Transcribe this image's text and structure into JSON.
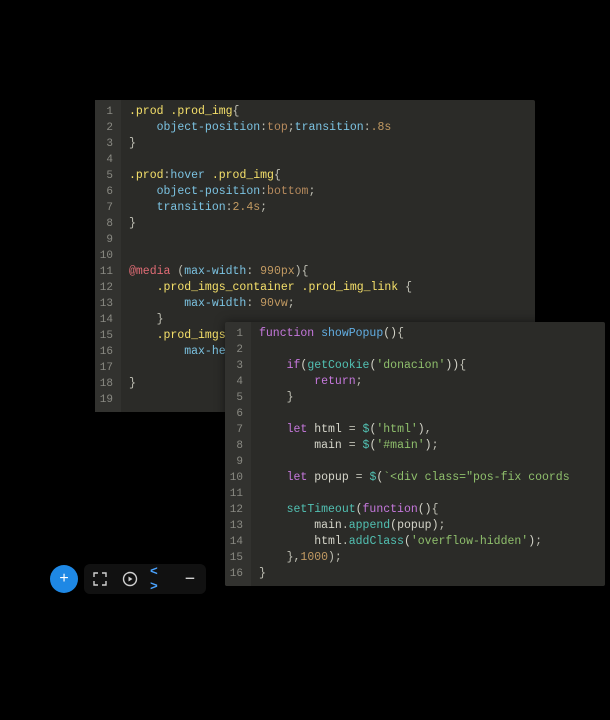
{
  "css_editor": {
    "lines": [
      {
        "n": 1,
        "tokens": [
          [
            "selector",
            ".prod "
          ],
          [
            "selector",
            ".prod_img"
          ],
          [
            "punct",
            "{"
          ]
        ]
      },
      {
        "n": 2,
        "indent": 1,
        "tokens": [
          [
            "prop",
            "object-position"
          ],
          [
            "punct",
            ":"
          ],
          [
            "value",
            "top"
          ],
          [
            "punct",
            ";"
          ],
          [
            "prop",
            "transition"
          ],
          [
            "punct",
            ":"
          ],
          [
            "number",
            ".8s"
          ]
        ]
      },
      {
        "n": 3,
        "tokens": [
          [
            "punct",
            "}"
          ]
        ]
      },
      {
        "n": 4,
        "tokens": []
      },
      {
        "n": 5,
        "tokens": [
          [
            "selector",
            ".prod"
          ],
          [
            "punct",
            ":"
          ],
          [
            "pseudo",
            "hover "
          ],
          [
            "selector",
            ".prod_img"
          ],
          [
            "punct",
            "{"
          ]
        ]
      },
      {
        "n": 6,
        "indent": 1,
        "tokens": [
          [
            "prop",
            "object-position"
          ],
          [
            "punct",
            ":"
          ],
          [
            "value",
            "bottom"
          ],
          [
            "punct",
            ";"
          ]
        ]
      },
      {
        "n": 7,
        "indent": 1,
        "tokens": [
          [
            "prop",
            "transition"
          ],
          [
            "punct",
            ":"
          ],
          [
            "number",
            "2.4s"
          ],
          [
            "punct",
            ";"
          ]
        ]
      },
      {
        "n": 8,
        "tokens": [
          [
            "punct",
            "}"
          ]
        ]
      },
      {
        "n": 9,
        "tokens": []
      },
      {
        "n": 10,
        "tokens": []
      },
      {
        "n": 11,
        "tokens": [
          [
            "keyword2",
            "@media "
          ],
          [
            "punct",
            "("
          ],
          [
            "prop",
            "max-width"
          ],
          [
            "punct",
            ": "
          ],
          [
            "number",
            "990px"
          ],
          [
            "punct",
            ")"
          ],
          [
            "punct",
            "{"
          ]
        ]
      },
      {
        "n": 12,
        "indent": 1,
        "tokens": [
          [
            "selector",
            ".prod_imgs_container "
          ],
          [
            "selector",
            ".prod_img_link "
          ],
          [
            "punct",
            "{"
          ]
        ]
      },
      {
        "n": 13,
        "indent": 2,
        "tokens": [
          [
            "prop",
            "max-width"
          ],
          [
            "punct",
            ": "
          ],
          [
            "number",
            "90vw"
          ],
          [
            "punct",
            ";"
          ]
        ]
      },
      {
        "n": 14,
        "indent": 1,
        "tokens": [
          [
            "punct",
            "}"
          ]
        ]
      },
      {
        "n": 15,
        "indent": 1,
        "tokens": [
          [
            "selector",
            ".prod_imgs"
          ]
        ]
      },
      {
        "n": 16,
        "indent": 2,
        "tokens": [
          [
            "prop",
            "max-he"
          ]
        ]
      },
      {
        "n": 17,
        "indent": 1,
        "tokens": [
          [
            "punct",
            ""
          ]
        ]
      },
      {
        "n": 18,
        "tokens": [
          [
            "punct",
            "}"
          ]
        ]
      },
      {
        "n": 19,
        "tokens": []
      }
    ]
  },
  "js_editor": {
    "lines": [
      {
        "n": 1,
        "tokens": [
          [
            "keyword",
            "function "
          ],
          [
            "func",
            "showPopup"
          ],
          [
            "paren",
            "()"
          ],
          [
            "punct",
            "{"
          ]
        ]
      },
      {
        "n": 2,
        "tokens": []
      },
      {
        "n": 3,
        "indent": 1,
        "tokens": [
          [
            "keyword",
            "if"
          ],
          [
            "paren",
            "("
          ],
          [
            "call",
            "getCookie"
          ],
          [
            "paren",
            "("
          ],
          [
            "string",
            "'donacion'"
          ],
          [
            "paren",
            "))"
          ],
          [
            "punct",
            "{"
          ]
        ]
      },
      {
        "n": 4,
        "indent": 2,
        "tokens": [
          [
            "keyword",
            "return"
          ],
          [
            "punct",
            ";"
          ]
        ]
      },
      {
        "n": 5,
        "indent": 1,
        "tokens": [
          [
            "punct",
            "}"
          ]
        ]
      },
      {
        "n": 6,
        "tokens": []
      },
      {
        "n": 7,
        "indent": 1,
        "tokens": [
          [
            "keyword",
            "let "
          ],
          [
            "ident",
            "html "
          ],
          [
            "punct",
            "= "
          ],
          [
            "call",
            "$"
          ],
          [
            "paren",
            "("
          ],
          [
            "string",
            "'html'"
          ],
          [
            "paren",
            ")"
          ],
          [
            "punct",
            ","
          ]
        ]
      },
      {
        "n": 8,
        "indent": 2,
        "tokens": [
          [
            "ident",
            "main "
          ],
          [
            "punct",
            "= "
          ],
          [
            "call",
            "$"
          ],
          [
            "paren",
            "("
          ],
          [
            "string",
            "'#main'"
          ],
          [
            "paren",
            ")"
          ],
          [
            "punct",
            ";"
          ]
        ]
      },
      {
        "n": 9,
        "tokens": []
      },
      {
        "n": 10,
        "indent": 1,
        "tokens": [
          [
            "keyword",
            "let "
          ],
          [
            "ident",
            "popup "
          ],
          [
            "punct",
            "= "
          ],
          [
            "call",
            "$"
          ],
          [
            "paren",
            "("
          ],
          [
            "string",
            "`<div class=\"pos-fix coords"
          ]
        ]
      },
      {
        "n": 11,
        "tokens": []
      },
      {
        "n": 12,
        "indent": 1,
        "tokens": [
          [
            "call",
            "setTimeout"
          ],
          [
            "paren",
            "("
          ],
          [
            "keyword",
            "function"
          ],
          [
            "paren",
            "()"
          ],
          [
            "punct",
            "{"
          ]
        ]
      },
      {
        "n": 13,
        "indent": 2,
        "tokens": [
          [
            "ident",
            "main"
          ],
          [
            "punct",
            "."
          ],
          [
            "method",
            "append"
          ],
          [
            "paren",
            "("
          ],
          [
            "ident",
            "popup"
          ],
          [
            "paren",
            ")"
          ],
          [
            "punct",
            ";"
          ]
        ]
      },
      {
        "n": 14,
        "indent": 2,
        "tokens": [
          [
            "ident",
            "html"
          ],
          [
            "punct",
            "."
          ],
          [
            "method",
            "addClass"
          ],
          [
            "paren",
            "("
          ],
          [
            "string",
            "'overflow-hidden'"
          ],
          [
            "paren",
            ")"
          ],
          [
            "punct",
            ";"
          ]
        ]
      },
      {
        "n": 15,
        "indent": 1,
        "tokens": [
          [
            "punct",
            "},"
          ],
          [
            "number",
            "1000"
          ],
          [
            "punct",
            ");"
          ]
        ]
      },
      {
        "n": 16,
        "tokens": [
          [
            "punct",
            "}"
          ]
        ]
      }
    ]
  },
  "toolbar": {
    "add_label": "+",
    "fullscreen_title": "fullscreen",
    "play_title": "play",
    "code_label": "< >",
    "minus_label": "—"
  }
}
